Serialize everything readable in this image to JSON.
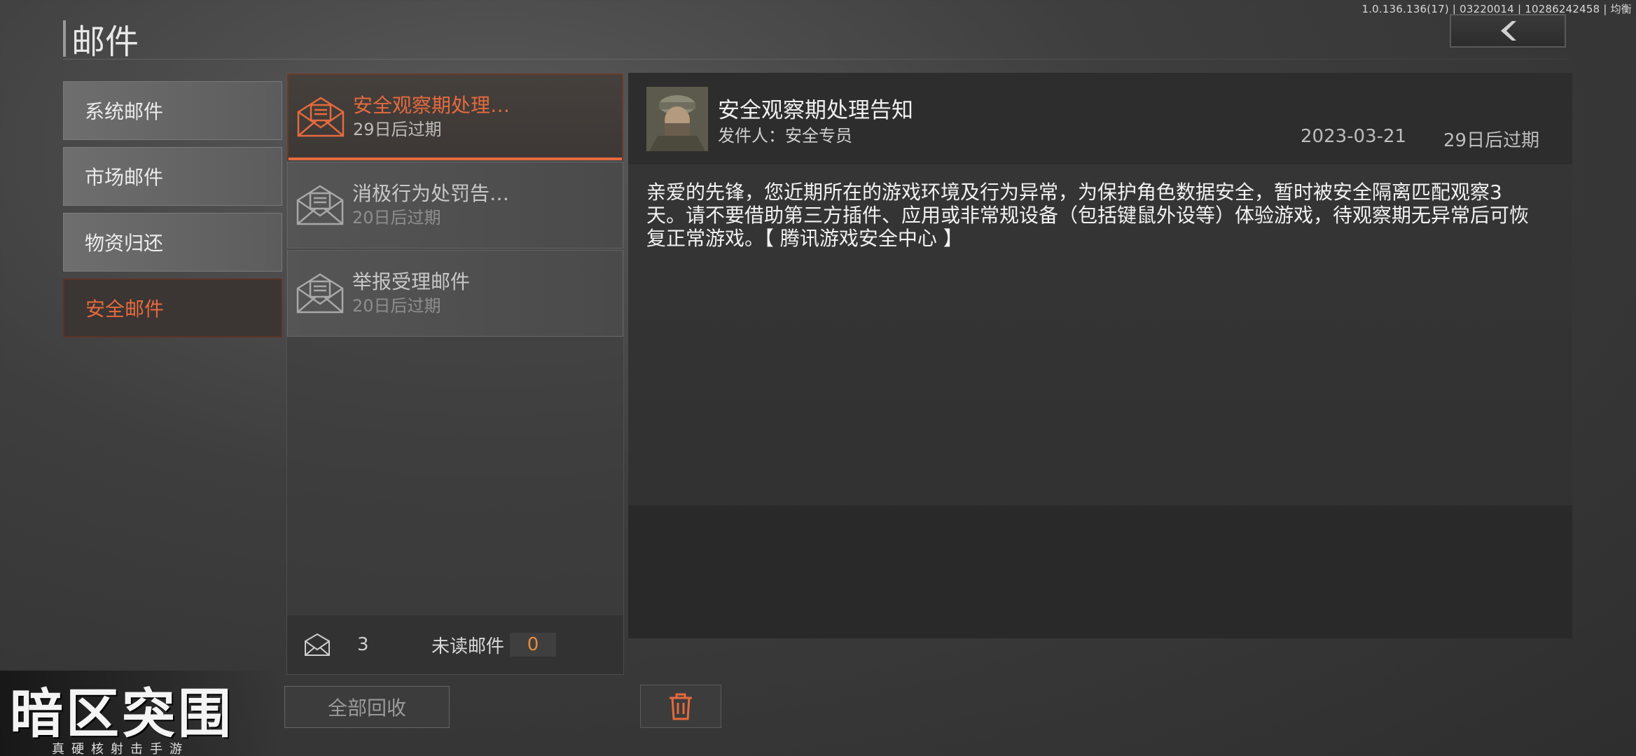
{
  "version": "1.0.136.136(17) | 03220014 | 10286242458 | 均衡",
  "header": {
    "title": "邮件"
  },
  "categories": [
    {
      "label": "系统邮件",
      "active": false
    },
    {
      "label": "市场邮件",
      "active": false
    },
    {
      "label": "物资归还",
      "active": false
    },
    {
      "label": "安全邮件",
      "active": true
    }
  ],
  "mails": [
    {
      "subject": "安全观察期处理…",
      "expiry": "29日后过期",
      "active": true
    },
    {
      "subject": "消极行为处罚告…",
      "expiry": "20日后过期",
      "active": false
    },
    {
      "subject": "举报受理邮件",
      "expiry": "20日后过期",
      "active": false
    }
  ],
  "footer": {
    "count": "3",
    "unread_label": "未读邮件",
    "unread_count": "0"
  },
  "collect_all_label": "全部回收",
  "detail": {
    "title": "安全观察期处理告知",
    "sender": "发件人：安全专员",
    "date": "2023-03-21",
    "expiry": "29日后过期",
    "body": "亲爱的先锋，您近期所在的游戏环境及行为异常，为保护角色数据安全，暂时被安全隔离匹配观察3天。请不要借助第三方插件、应用或非常规设备（包括键鼠外设等）体验游戏，待观察期无异常后可恢复正常游戏。【 腾讯游戏安全中心 】"
  },
  "logo": {
    "main": "暗区突围",
    "sub": "真硬核射击手游"
  },
  "icons": {
    "back": "chevron-left-icon",
    "mail": "envelope-icon",
    "delete": "trash-icon"
  },
  "colors": {
    "accent": "#e56a3e",
    "unread": "#e58c3e"
  }
}
